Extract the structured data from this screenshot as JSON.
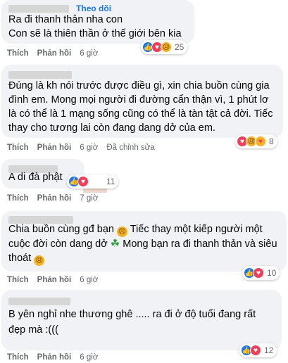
{
  "comments": [
    {
      "follow_label": "Theo dõi",
      "text": "Ra đi thanh thản nha con\nCon sẽ là thiên thần ở thế giới bên kia",
      "actions": [
        "Thích",
        "Phản hồi",
        "6 giờ"
      ],
      "reaction_icons": [
        "like-icon",
        "love-icon",
        "sad-icon"
      ],
      "reaction_count": "25"
    },
    {
      "text": "Đúng là kh nói trước được điều gì, xin chia buồn cùng gia đình em. Mong mọi người đi đường cẩn thận vì, 1 phút lơ là có thể là 1 mạng sống cũng có thể là tàn tật cả đời. Tiếc thay cho tương lai còn đang dang dở của em.",
      "actions": [
        "Thích",
        "Phản hồi",
        "6 giờ",
        "Đã chỉnh sửa"
      ],
      "reaction_icons": [
        "love-icon",
        "sad-icon",
        "care-icon"
      ],
      "reaction_count": "8"
    },
    {
      "text": "A di đà phật",
      "actions": [
        "Thích",
        "Phản hồi",
        "7 giờ"
      ],
      "reaction_icons": [
        "like-icon",
        "love-icon"
      ],
      "reaction_count": "11"
    },
    {
      "text_before_emoji1": "Chia buồn cùng gđ bạn ",
      "text_mid": " Tiếc thay một kiếp người một cuộc đời còn dang dở ",
      "text_after_clover": " Mong bạn ra đi thanh thản và siêu thoát ",
      "actions": [
        "Thích",
        "Phản hồi",
        "6 giờ"
      ],
      "reaction_icons": [
        "like-icon",
        "love-icon"
      ],
      "reaction_count": "10"
    },
    {
      "text": "B yên nghỉ nhe thương ghê ..... ra đi ở độ tuổi đang rất đẹp mà :(((",
      "actions": [
        "Thích",
        "Phản hồi",
        "6 giờ"
      ],
      "reaction_icons": [
        "like-icon",
        "love-icon"
      ],
      "reaction_count": "12"
    }
  ],
  "colors": {
    "bubble": "#f0f2f5",
    "like": "#1877f2",
    "love": "#f33e58",
    "sad": "#f7b125",
    "meta": "#65676b"
  }
}
